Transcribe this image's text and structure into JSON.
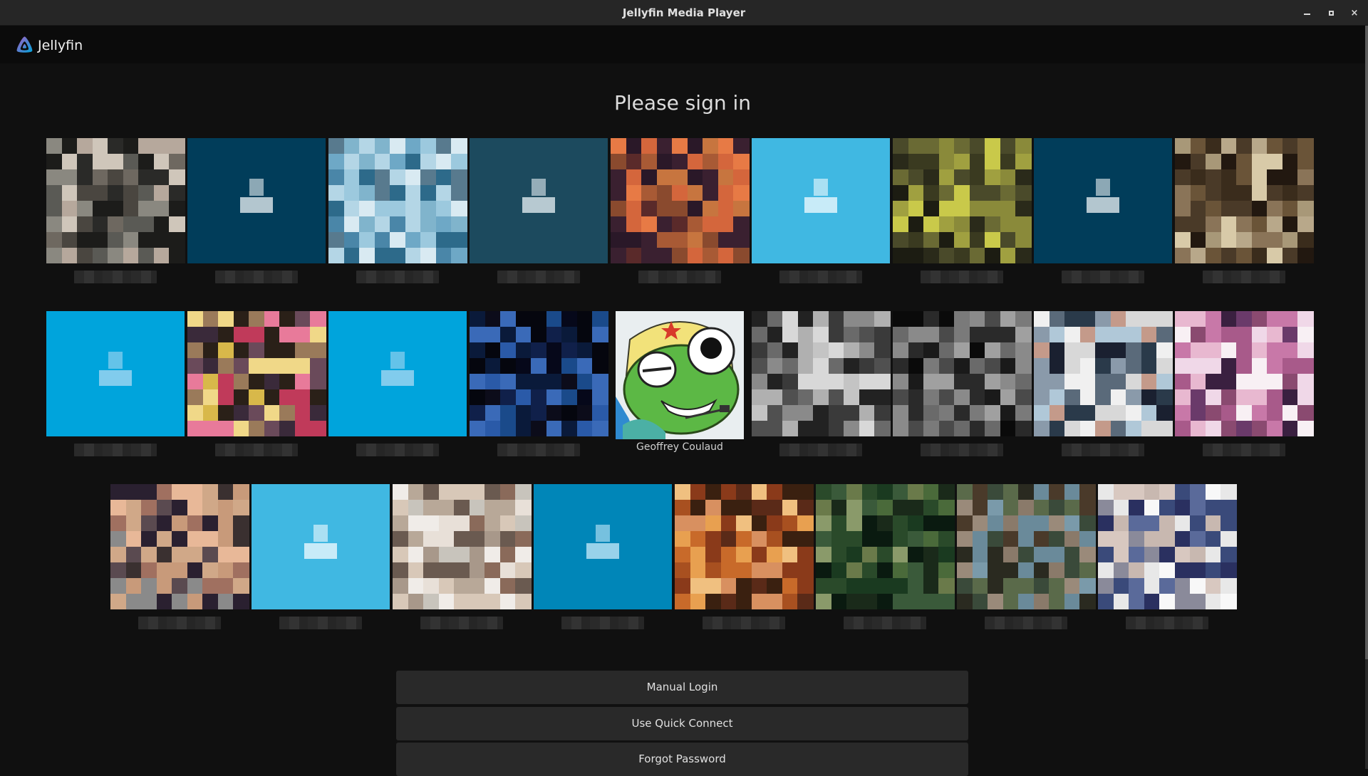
{
  "window": {
    "title": "Jellyfin Media Player",
    "controls": {
      "minimize": "minimize",
      "maximize": "maximize",
      "close": "×"
    }
  },
  "header": {
    "brand": "Jellyfin"
  },
  "page": {
    "heading": "Please sign in"
  },
  "users": [
    {
      "name": "",
      "type": "photo",
      "palette": [
        "#5a5a55",
        "#8a8880",
        "#2a2a28",
        "#b6a89c",
        "#4a4640",
        "#cfc6ba",
        "#6e6860",
        "#1c1c1a"
      ]
    },
    {
      "name": "",
      "type": "default",
      "bg": "#013d5a",
      "fg": "#c7d5dc"
    },
    {
      "name": "",
      "type": "photo",
      "palette": [
        "#6ea8c6",
        "#9cc9de",
        "#4a86a8",
        "#d9eaf2",
        "#80b4cc",
        "#2d6a8a",
        "#b4d6e6",
        "#587a8e"
      ]
    },
    {
      "name": "",
      "type": "default",
      "bg": "#1c4a5e",
      "fg": "#c9d7de"
    },
    {
      "name": "",
      "type": "photo",
      "palette": [
        "#2a1828",
        "#d4663c",
        "#8a4a2e",
        "#3a2030",
        "#e77a45",
        "#a85a35",
        "#5a2a2a",
        "#c7753f"
      ]
    },
    {
      "name": "",
      "type": "default",
      "bg": "#40b8e2",
      "fg": "#d7f1fb"
    },
    {
      "name": "",
      "type": "photo",
      "palette": [
        "#1c1c12",
        "#4a4a2a",
        "#8a8a3a",
        "#2a2a1a",
        "#c9c94a",
        "#6a6a34",
        "#3a3a20",
        "#a0a040"
      ]
    },
    {
      "name": "",
      "type": "default",
      "bg": "#013d5a",
      "fg": "#c7d5dc"
    },
    {
      "name": "",
      "type": "photo",
      "palette": [
        "#3a2c1c",
        "#b8a88a",
        "#6a5438",
        "#d8caa8",
        "#221810",
        "#8a7458",
        "#4a3a28",
        "#a89878"
      ]
    },
    {
      "name": "",
      "type": "default",
      "bg": "#00a4dc",
      "fg": "#8fd0ee"
    },
    {
      "name": "",
      "type": "photo",
      "palette": [
        "#2a2018",
        "#d8b84a",
        "#e87a9a",
        "#6a4a5a",
        "#f0d888",
        "#c03a5a",
        "#3a2a3a",
        "#9a7a5a"
      ]
    },
    {
      "name": "",
      "type": "default",
      "bg": "#00a4dc",
      "fg": "#8fd0ee"
    },
    {
      "name": "",
      "type": "photo",
      "palette": [
        "#05060e",
        "#0a1a3a",
        "#1a4a8a",
        "#0c0c1a",
        "#2a5aa8",
        "#10204a",
        "#06081a",
        "#3a6ab8"
      ]
    },
    {
      "name": "Geoffrey Coulaud",
      "type": "avatar-frog"
    },
    {
      "name": "",
      "type": "photo",
      "palette": [
        "#6a6a6a",
        "#b0b0b0",
        "#3a3a3a",
        "#d8d8d8",
        "#8a8a8a",
        "#505050",
        "#c4c4c4",
        "#222222"
      ]
    },
    {
      "name": "",
      "type": "photo",
      "palette": [
        "#1a1a1a",
        "#7a7a7a",
        "#4a4a4a",
        "#a0a0a0",
        "#2a2a2a",
        "#6a6a6a",
        "#0a0a0a",
        "#8a8a8a"
      ]
    },
    {
      "name": "",
      "type": "photo",
      "palette": [
        "#1a2030",
        "#d8d8d8",
        "#8a9aaa",
        "#c49a8a",
        "#f0f0f0",
        "#5a6a7a",
        "#2a3a4a",
        "#b0c8d8"
      ]
    },
    {
      "name": "",
      "type": "photo",
      "palette": [
        "#c878a8",
        "#f0d8e8",
        "#6a3a6a",
        "#e8b8d0",
        "#a85a8a",
        "#3a2040",
        "#f8f0f4",
        "#8a4a70"
      ]
    },
    {
      "name": "",
      "type": "photo",
      "palette": [
        "#8a8a8a",
        "#c89a7a",
        "#2a2030",
        "#e8b898",
        "#5a4a50",
        "#a07060",
        "#3a3030",
        "#d0a888"
      ]
    },
    {
      "name": "",
      "type": "default",
      "bg": "#40b8e2",
      "fg": "#d7f1fb"
    },
    {
      "name": "",
      "type": "photo",
      "palette": [
        "#c8c4bc",
        "#a8988a",
        "#e8e0d8",
        "#8a6a5a",
        "#d8c8b8",
        "#6a5a50",
        "#b8a898",
        "#f0ece8"
      ]
    },
    {
      "name": "",
      "type": "default",
      "bg": "#0086b8",
      "fg": "#a8daf0"
    },
    {
      "name": "",
      "type": "photo",
      "palette": [
        "#3a2010",
        "#c86a2a",
        "#e8a050",
        "#8a3a1a",
        "#f0c080",
        "#5a2a18",
        "#a85020",
        "#d89060"
      ]
    },
    {
      "name": "",
      "type": "photo",
      "palette": [
        "#1a2a1a",
        "#3a5a3a",
        "#6a7a4a",
        "#2a4a2a",
        "#8a9a6a",
        "#1a3a20",
        "#4a6a3a",
        "#0a1a10"
      ]
    },
    {
      "name": "",
      "type": "photo",
      "palette": [
        "#4a3a2a",
        "#7a9aaa",
        "#5a6a4a",
        "#8a7a6a",
        "#3a4a3a",
        "#6a8a9a",
        "#2a2a20",
        "#9a8a7a"
      ]
    },
    {
      "name": "",
      "type": "photo",
      "palette": [
        "#e8e8e8",
        "#3a4a7a",
        "#c8b8b0",
        "#f8f8f8",
        "#8a8a9a",
        "#2a3060",
        "#d8c8c0",
        "#5a6a9a"
      ]
    }
  ],
  "actions": {
    "manual_login": "Manual Login",
    "quick_connect": "Use Quick Connect",
    "forgot_password": "Forgot Password"
  },
  "colors": {
    "background": "#101010",
    "button_bg": "#292929",
    "jellyfin_accent_purple": "#aa5cc3",
    "jellyfin_accent_blue": "#00a4dc"
  }
}
